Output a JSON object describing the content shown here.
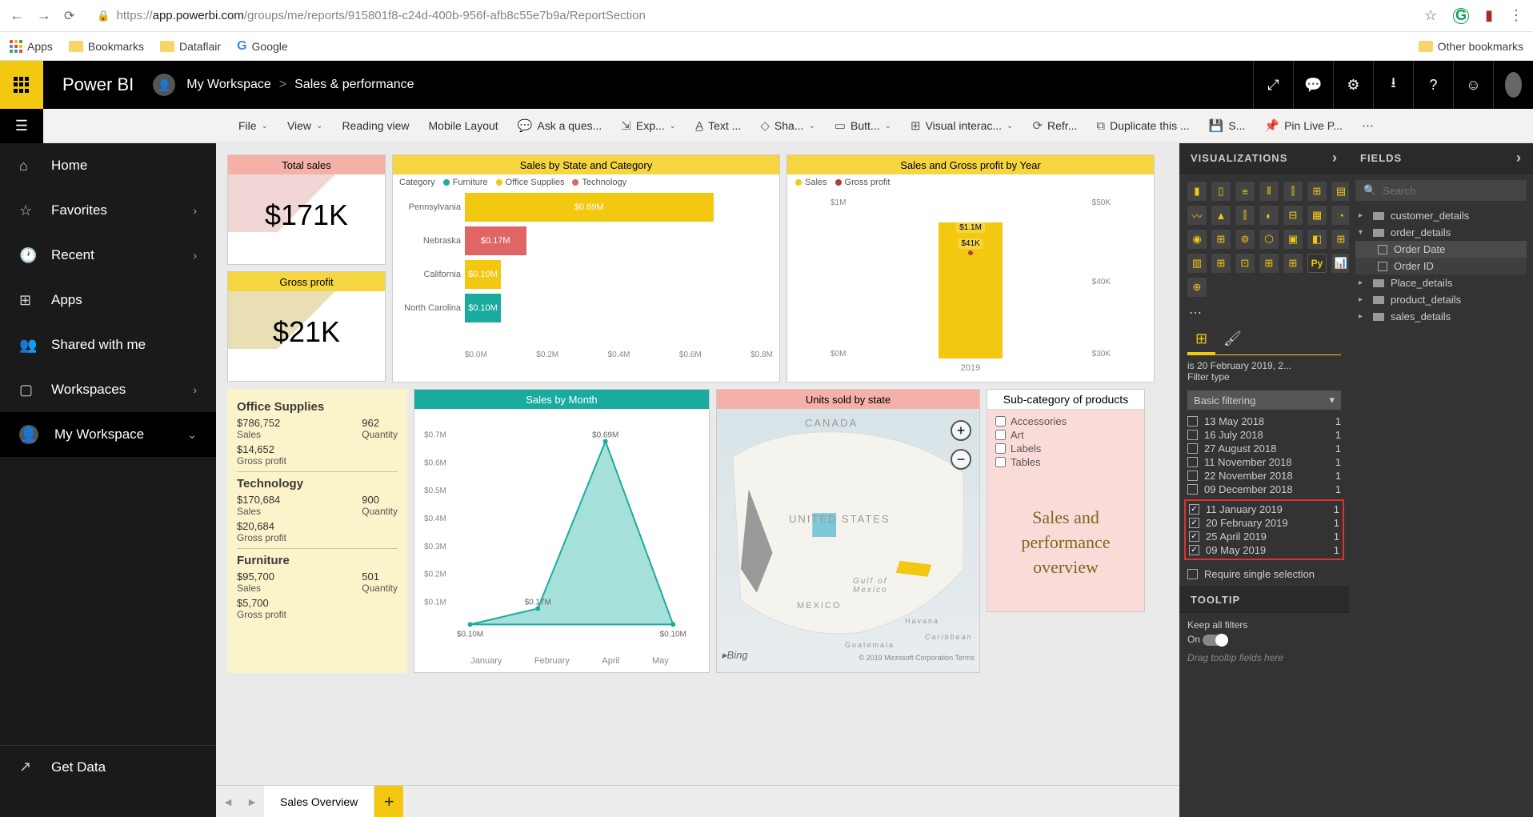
{
  "browser": {
    "url_prefix": "https://",
    "url_host": "app.powerbi.com",
    "url_path": "/groups/me/reports/915801f8-c24d-400b-956f-afb8c55e7b9a/ReportSection",
    "bookmarks": {
      "apps": "Apps",
      "bookmarks": "Bookmarks",
      "dataflair": "Dataflair",
      "google": "Google",
      "other": "Other bookmarks"
    }
  },
  "header": {
    "app": "Power BI",
    "workspace": "My Workspace",
    "sep": ">",
    "report": "Sales & performance"
  },
  "toolbar": {
    "file": "File",
    "view": "View",
    "reading": "Reading view",
    "mobile": "Mobile Layout",
    "ask": "Ask a ques...",
    "explore": "Exp...",
    "text": "Text ...",
    "shapes": "Sha...",
    "buttons": "Butt...",
    "visual": "Visual interac...",
    "refresh": "Refr...",
    "duplicate": "Duplicate this ...",
    "save": "S...",
    "pin": "Pin Live P..."
  },
  "nav": {
    "home": "Home",
    "favorites": "Favorites",
    "recent": "Recent",
    "apps": "Apps",
    "shared": "Shared with me",
    "workspaces": "Workspaces",
    "myworkspace": "My Workspace",
    "getdata": "Get Data"
  },
  "kpi": {
    "total_sales_title": "Total sales",
    "total_sales_val": "$171K",
    "gross_profit_title": "Gross profit",
    "gross_profit_val": "$21K"
  },
  "chart_data": [
    {
      "id": "sales_state",
      "type": "bar",
      "title": "Sales by State and Category",
      "legend_label": "Category",
      "series_names": [
        "Furniture",
        "Office Supplies",
        "Technology"
      ],
      "series_colors": [
        "#1aab9f",
        "#f2c811",
        "#e06666"
      ],
      "categories": [
        "Pennsylvania",
        "Nebraska",
        "California",
        "North Carolina"
      ],
      "values": [
        0.69,
        0.17,
        0.1,
        0.1
      ],
      "labels": [
        "$0.69M",
        "$0.17M",
        "$0.10M",
        "$0.10M"
      ],
      "colors": [
        "#f2c811",
        "#e06666",
        "#f2c811",
        "#1aab9f"
      ],
      "xticks": [
        "$0.0M",
        "$0.2M",
        "$0.4M",
        "$0.6M",
        "$0.8M"
      ],
      "xlim": [
        0,
        0.8
      ]
    },
    {
      "id": "sales_year",
      "type": "bar",
      "title": "Sales and Gross profit by Year",
      "legend": [
        {
          "name": "Sales",
          "color": "#f2c811"
        },
        {
          "name": "Gross profit",
          "color": "#b73a3a"
        }
      ],
      "categories": [
        "2019"
      ],
      "sales": [
        1.1
      ],
      "sales_label": "$1.1M",
      "gross_profit": [
        41
      ],
      "gp_label": "$41K",
      "y_left": [
        "$0M",
        "$1M"
      ],
      "y_right": [
        "$30K",
        "$40K",
        "$50K"
      ]
    },
    {
      "id": "sales_month",
      "type": "area",
      "title": "Sales by Month",
      "x": [
        "January",
        "February",
        "April",
        "May"
      ],
      "y": [
        0.1,
        0.17,
        0.69,
        0.1
      ],
      "labels": [
        "$0.10M",
        "$0.17M",
        "$0.69M",
        "$0.10M"
      ],
      "yticks": [
        "$0.1M",
        "$0.2M",
        "$0.3M",
        "$0.4M",
        "$0.5M",
        "$0.6M",
        "$0.7M"
      ],
      "ylim": [
        0,
        0.75
      ]
    },
    {
      "id": "map",
      "type": "map",
      "title": "Units sold by state",
      "labels": {
        "canada": "CANADA",
        "us": "UNITED STATES",
        "mexico": "MEXICO",
        "gulf": "Gulf of\nMexico",
        "havana": "Havana",
        "guatemala": "Guatemala",
        "caribbean": "Caribbean"
      },
      "attribution_brand": "Bing",
      "attribution_copy": "© 2019 Microsoft Corporation  Terms"
    }
  ],
  "category_summary": [
    {
      "name": "Office Supplies",
      "sales": "$786,752",
      "sales_lbl": "Sales",
      "qty": "962",
      "qty_lbl": "Quantity",
      "gp": "$14,652",
      "gp_lbl": "Gross profit"
    },
    {
      "name": "Technology",
      "sales": "$170,684",
      "sales_lbl": "Sales",
      "qty": "900",
      "qty_lbl": "Quantity",
      "gp": "$20,684",
      "gp_lbl": "Gross profit"
    },
    {
      "name": "Furniture",
      "sales": "$95,700",
      "sales_lbl": "Sales",
      "qty": "501",
      "qty_lbl": "Quantity",
      "gp": "$5,700",
      "gp_lbl": "Gross profit"
    }
  ],
  "subcat": {
    "title": "Sub-category of products",
    "items": [
      "Accessories",
      "Art",
      "Labels",
      "Tables"
    ]
  },
  "overview_text": "Sales and performance overview",
  "tabs": {
    "t1": "Sales Overview"
  },
  "viz_panel": {
    "title": "VISUALIZATIONS"
  },
  "fields_panel": {
    "title": "FIELDS",
    "search_ph": "Search",
    "tables": [
      "customer_details",
      "order_details",
      "Place_details",
      "product_details",
      "sales_details"
    ],
    "order_fields": [
      "Order Date",
      "Order ID"
    ]
  },
  "filter": {
    "summary": "is 20 February 2019, 2...",
    "type_label": "Filter type",
    "type_value": "Basic filtering",
    "items": [
      {
        "label": "13 May 2018",
        "count": "1",
        "checked": false
      },
      {
        "label": "16 July 2018",
        "count": "1",
        "checked": false
      },
      {
        "label": "27 August 2018",
        "count": "1",
        "checked": false
      },
      {
        "label": "11 November 2018",
        "count": "1",
        "checked": false
      },
      {
        "label": "22 November 2018",
        "count": "1",
        "checked": false
      },
      {
        "label": "09 December 2018",
        "count": "1",
        "checked": false
      },
      {
        "label": "11 January 2019",
        "count": "1",
        "checked": true
      },
      {
        "label": "20 February 2019",
        "count": "1",
        "checked": true
      },
      {
        "label": "25 April 2019",
        "count": "1",
        "checked": true
      },
      {
        "label": "09 May 2019",
        "count": "1",
        "checked": true
      }
    ],
    "require_single": "Require single selection"
  },
  "tooltip": {
    "title": "TOOLTIP",
    "keep": "Keep all filters",
    "on": "On",
    "drag": "Drag tooltip fields here"
  }
}
